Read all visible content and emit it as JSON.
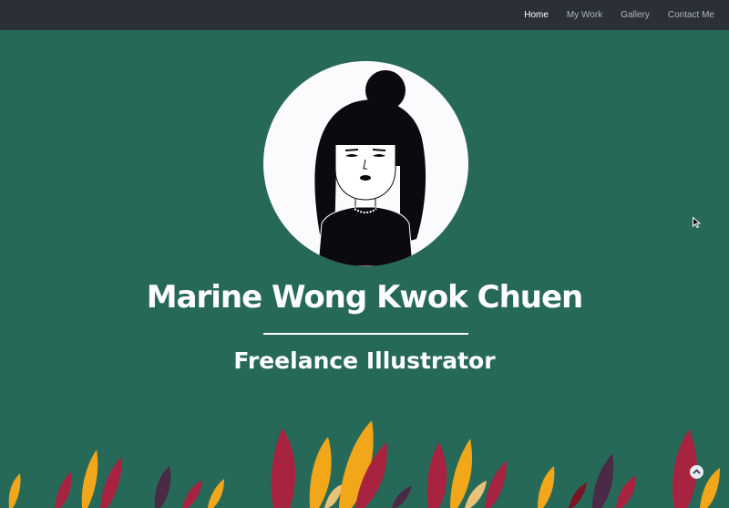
{
  "nav": {
    "items": [
      {
        "label": "Home",
        "active": true
      },
      {
        "label": "My Work",
        "active": false
      },
      {
        "label": "Gallery",
        "active": false
      },
      {
        "label": "Contact Me",
        "active": false
      }
    ]
  },
  "hero": {
    "name": "Marine Wong Kwok Chuen",
    "title": "Freelance Illustrator"
  },
  "icons": {
    "scroll_top": "chevron-up-icon",
    "avatar": "avatar-illustration"
  },
  "colors": {
    "background": "#276959",
    "navbar": "#2b2f38",
    "text": "#ffffff",
    "nav_link": "#aeb6bd"
  }
}
